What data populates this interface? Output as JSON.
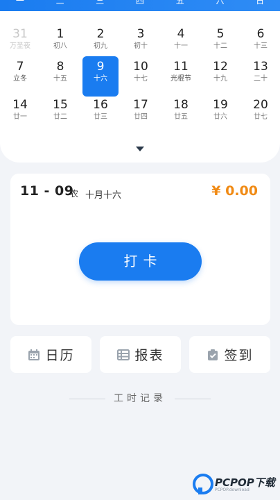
{
  "weekdays": [
    "一",
    "二",
    "三",
    "四",
    "五",
    "六",
    "日"
  ],
  "calendar": {
    "rows": [
      [
        {
          "day": "31",
          "lunar": "万圣夜",
          "state": "faded"
        },
        {
          "day": "1",
          "lunar": "初八",
          "state": "normal"
        },
        {
          "day": "2",
          "lunar": "初九",
          "state": "normal"
        },
        {
          "day": "3",
          "lunar": "初十",
          "state": "normal"
        },
        {
          "day": "4",
          "lunar": "十一",
          "state": "normal"
        },
        {
          "day": "5",
          "lunar": "十二",
          "state": "normal"
        },
        {
          "day": "6",
          "lunar": "十三",
          "state": "normal"
        }
      ],
      [
        {
          "day": "7",
          "lunar": "立冬",
          "state": "term"
        },
        {
          "day": "8",
          "lunar": "十五",
          "state": "normal"
        },
        {
          "day": "9",
          "lunar": "十六",
          "state": "selected"
        },
        {
          "day": "10",
          "lunar": "十七",
          "state": "normal"
        },
        {
          "day": "11",
          "lunar": "光棍节",
          "state": "term"
        },
        {
          "day": "12",
          "lunar": "十九",
          "state": "normal"
        },
        {
          "day": "13",
          "lunar": "二十",
          "state": "normal"
        }
      ],
      [
        {
          "day": "14",
          "lunar": "廿一",
          "state": "normal"
        },
        {
          "day": "15",
          "lunar": "廿二",
          "state": "normal"
        },
        {
          "day": "16",
          "lunar": "廿三",
          "state": "normal"
        },
        {
          "day": "17",
          "lunar": "廿四",
          "state": "normal"
        },
        {
          "day": "18",
          "lunar": "廿五",
          "state": "normal"
        },
        {
          "day": "19",
          "lunar": "廿六",
          "state": "normal"
        },
        {
          "day": "20",
          "lunar": "廿七",
          "state": "normal"
        }
      ]
    ],
    "expand_icon": "chevron-down-icon"
  },
  "card": {
    "date": "11 - 09",
    "lunar_tag": "农",
    "lunar_date": "十月十六",
    "amount": "¥ 0.00",
    "amount_color": "#f08a14",
    "punch_label": "打卡"
  },
  "tools": [
    {
      "name": "calendar",
      "label": "日历",
      "icon": "calendar-icon"
    },
    {
      "name": "report",
      "label": "报表",
      "icon": "table-icon"
    },
    {
      "name": "checkin",
      "label": "签到",
      "icon": "clipboard-check-icon"
    }
  ],
  "records_label": "工时记录",
  "watermark": {
    "brand": "PCPOP下载",
    "sub": "PCPOP.download"
  },
  "colors": {
    "accent": "#1a7cf0",
    "background": "#f2f4f8"
  }
}
